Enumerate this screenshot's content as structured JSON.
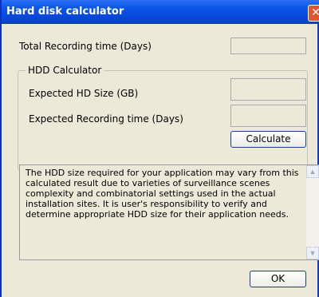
{
  "window": {
    "title": "Hard disk calculator",
    "close_glyph": "✕"
  },
  "total_recording": {
    "label": "Total Recording time (Days)",
    "value": ""
  },
  "hdd_calculator": {
    "group_label": "HDD Calculator",
    "expected_hd_size_label": "Expected HD Size (GB)",
    "expected_hd_size_value": "",
    "expected_recording_label": "Expected Recording time (Days)",
    "expected_recording_value": "",
    "calculate_label": "Calculate"
  },
  "note": {
    "text": "The HDD size required for your application may vary from this calculated result due to varieties of surveillance scenes complexity and combinatorial settings used in the actual installation sites. It is user's responsibility to verify and determine appropriate HDD size for their application needs."
  },
  "scrollbar": {
    "up_glyph": "▲",
    "down_glyph": "▼"
  },
  "ok_label": "OK"
}
